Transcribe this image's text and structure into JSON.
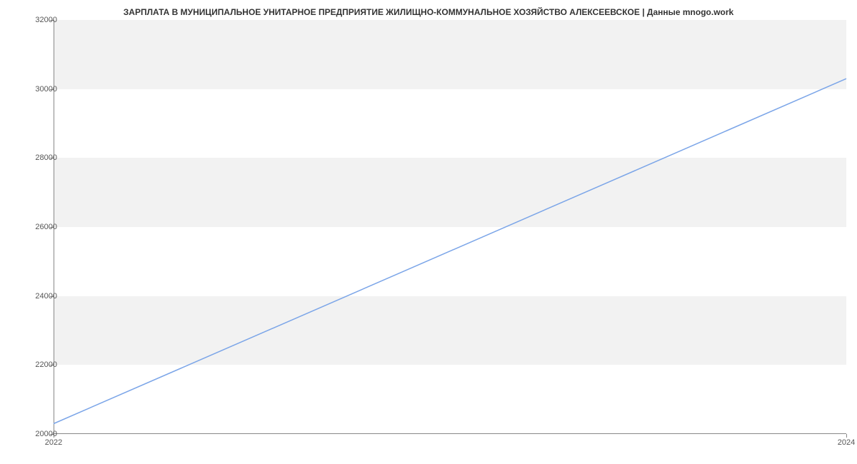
{
  "chart_data": {
    "type": "line",
    "title": "ЗАРПЛАТА В МУНИЦИПАЛЬНОЕ УНИТАРНОЕ ПРЕДПРИЯТИЕ ЖИЛИЩНО-КОММУНАЛЬНОЕ ХОЗЯЙСТВО АЛЕКСЕЕВСКОЕ | Данные mnogo.work",
    "x": [
      2022,
      2024
    ],
    "values": [
      20300,
      30300
    ],
    "xlabel": "",
    "ylabel": "",
    "ylim": [
      20000,
      32000
    ],
    "xlim": [
      2022,
      2024
    ],
    "y_ticks": [
      20000,
      22000,
      24000,
      26000,
      28000,
      30000,
      32000
    ],
    "x_ticks": [
      2022,
      2024
    ],
    "line_color": "#7ba5e8"
  }
}
